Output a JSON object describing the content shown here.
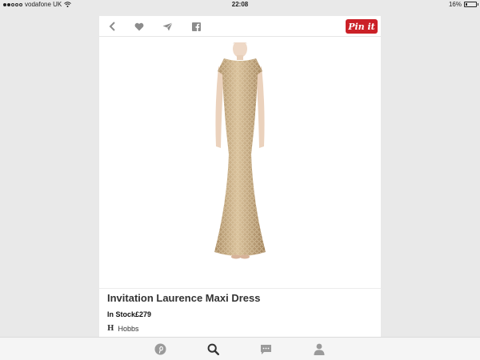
{
  "status_bar": {
    "carrier": "vodafone UK",
    "time": "22:08",
    "battery_text": "16%",
    "battery_level": 0.16
  },
  "toolbar": {
    "icons": [
      "back-icon",
      "heart-icon",
      "send-icon",
      "facebook-icon"
    ],
    "pin_label": "Pin it"
  },
  "product": {
    "title": "Invitation Laurence Maxi Dress",
    "stock_price": "In Stock£279",
    "brand_initial": "H",
    "brand": "Hobbs"
  },
  "bottom_nav": {
    "icons": [
      "pinterest-icon",
      "search-icon",
      "messages-icon",
      "profile-icon"
    ]
  },
  "colors": {
    "pin_red": "#cb2027",
    "dress_gold": "#c9aa80",
    "background": "#e9e9e9",
    "card": "#ffffff"
  }
}
